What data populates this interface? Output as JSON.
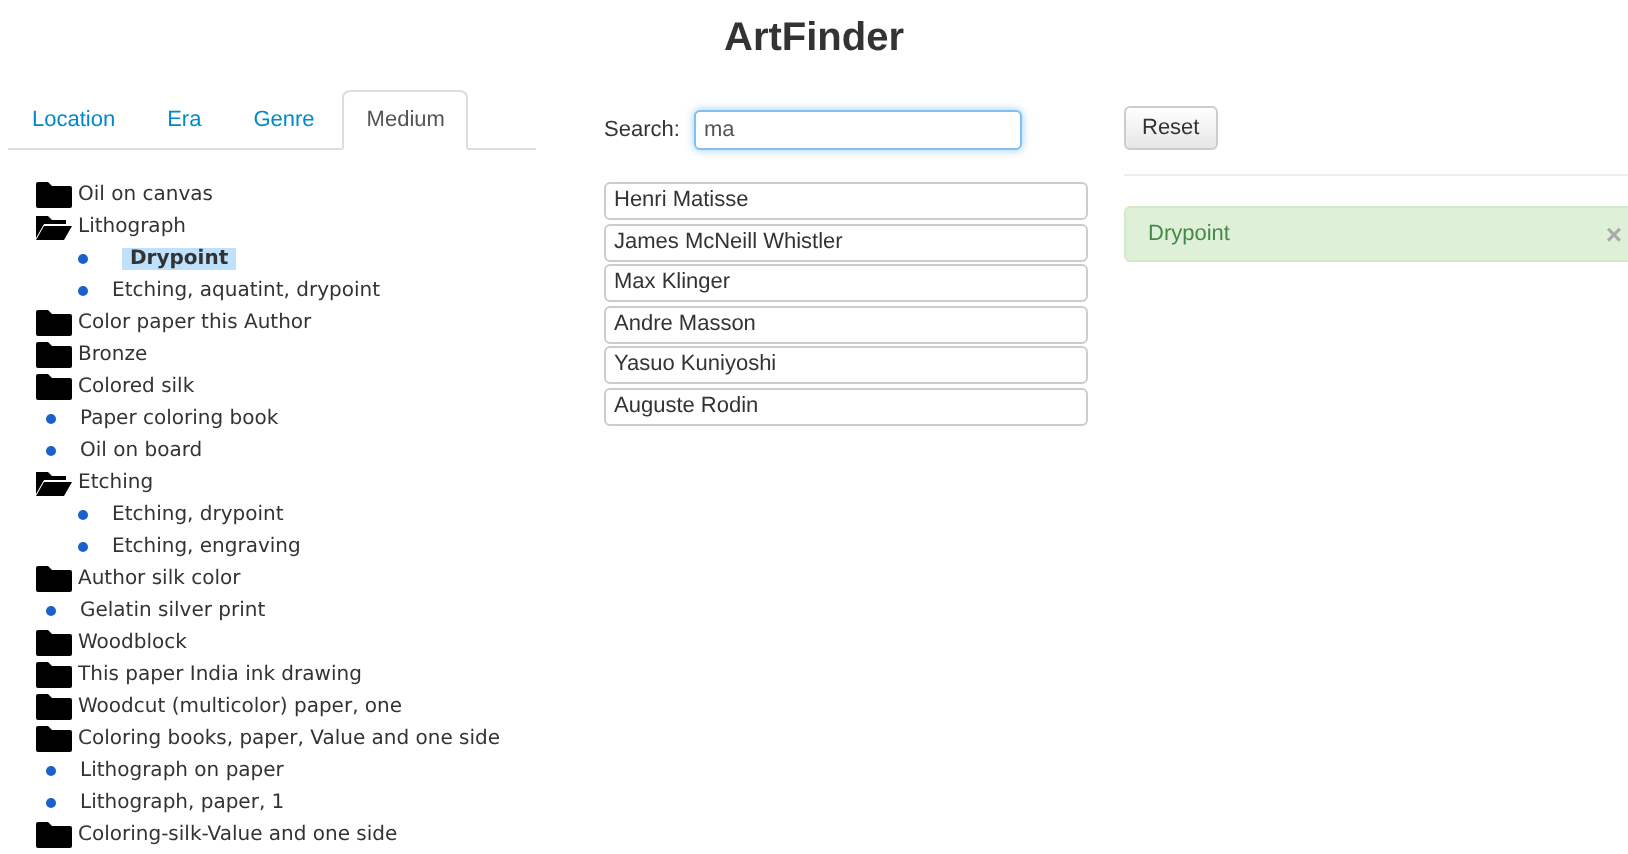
{
  "title": "ArtFinder",
  "tabs": [
    {
      "label": "Location",
      "selected": false
    },
    {
      "label": "Era",
      "selected": false
    },
    {
      "label": "Genre",
      "selected": false
    },
    {
      "label": "Medium",
      "selected": true
    }
  ],
  "tree": [
    {
      "kind": "folder",
      "label": "Oil on canvas",
      "expanded": false
    },
    {
      "kind": "folder",
      "label": "Lithograph",
      "expanded": true,
      "children": [
        {
          "kind": "leaf",
          "label": "Drypoint",
          "selected": true
        },
        {
          "kind": "leaf",
          "label": "Etching, aquatint, drypoint",
          "selected": false
        }
      ]
    },
    {
      "kind": "folder",
      "label": "Color paper this Author",
      "expanded": false
    },
    {
      "kind": "folder",
      "label": "Bronze",
      "expanded": false
    },
    {
      "kind": "folder",
      "label": "Colored silk",
      "expanded": false
    },
    {
      "kind": "leaf",
      "label": "Paper coloring book",
      "selected": false
    },
    {
      "kind": "leaf",
      "label": "Oil on board",
      "selected": false
    },
    {
      "kind": "folder",
      "label": "Etching",
      "expanded": true,
      "children": [
        {
          "kind": "leaf",
          "label": "Etching, drypoint",
          "selected": false
        },
        {
          "kind": "leaf",
          "label": "Etching, engraving",
          "selected": false
        }
      ]
    },
    {
      "kind": "folder",
      "label": "Author silk color",
      "expanded": false
    },
    {
      "kind": "leaf",
      "label": "Gelatin silver print",
      "selected": false
    },
    {
      "kind": "folder",
      "label": "Woodblock",
      "expanded": false
    },
    {
      "kind": "folder",
      "label": "This paper India ink drawing",
      "expanded": false
    },
    {
      "kind": "folder",
      "label": "Woodcut (multicolor) paper, one",
      "expanded": false
    },
    {
      "kind": "folder",
      "label": "Coloring books, paper, Value and one side",
      "expanded": false
    },
    {
      "kind": "leaf",
      "label": "Lithograph on paper",
      "selected": false
    },
    {
      "kind": "leaf",
      "label": "Lithograph, paper, 1",
      "selected": false
    },
    {
      "kind": "folder",
      "label": "Coloring-silk-Value and one side",
      "expanded": false
    }
  ],
  "search": {
    "label": "Search:",
    "value": "ma"
  },
  "results": [
    "Henri Matisse",
    "James McNeill Whistler",
    "Max Klinger",
    "Andre Masson",
    "Yasuo Kuniyoshi",
    "Auguste Rodin"
  ],
  "reset_button": "Reset",
  "filter_alert": {
    "text": "Drypoint",
    "close": "×"
  }
}
